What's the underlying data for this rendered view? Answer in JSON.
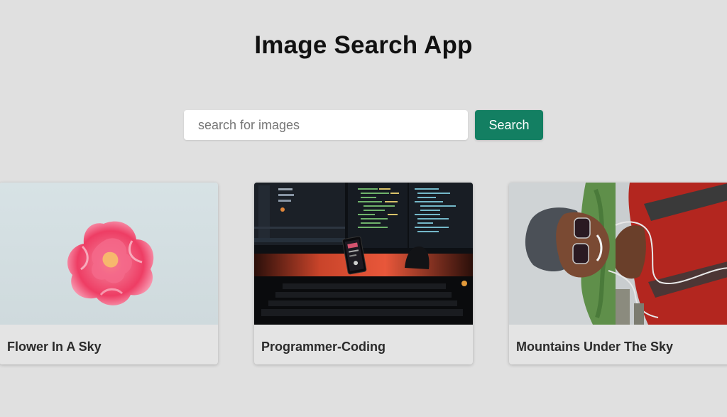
{
  "header": {
    "title": "Image Search App"
  },
  "search": {
    "placeholder": "search for images",
    "value": "",
    "button_label": "Search"
  },
  "colors": {
    "background": "#e0e0e0",
    "accent": "#137f62"
  },
  "results": [
    {
      "caption": "Flower In A Sky",
      "image_subject": "pink-flower-on-sky"
    },
    {
      "caption": "Programmer-Coding",
      "image_subject": "code-monitors-keyboard"
    },
    {
      "caption": "Mountains Under The Sky",
      "image_subject": "person-selfie-rotated"
    }
  ]
}
